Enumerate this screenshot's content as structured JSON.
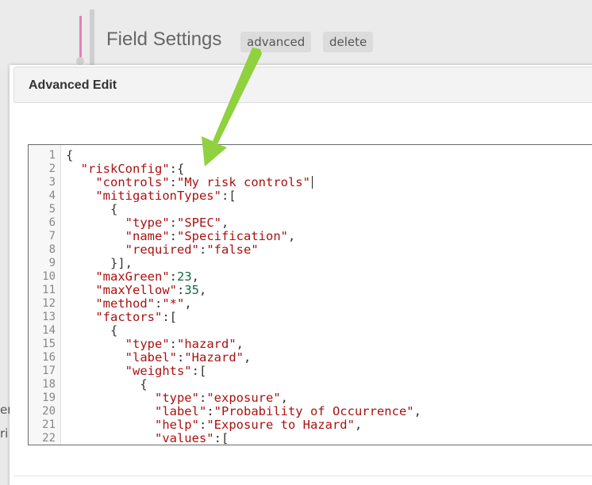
{
  "background": {
    "field_settings_title": "Field Settings",
    "advanced_button": "advanced",
    "delete_button": "delete",
    "edge_text_1": "er",
    "edge_text_2": "ri"
  },
  "modal": {
    "title": "Advanced Edit"
  },
  "editor": {
    "lines": [
      {
        "n": "1",
        "text": "{"
      },
      {
        "n": "2",
        "text": "  \"riskConfig\":{"
      },
      {
        "n": "3",
        "text": "    \"controls\":\"My risk controls\""
      },
      {
        "n": "4",
        "text": "    \"mitigationTypes\":["
      },
      {
        "n": "5",
        "text": "      {"
      },
      {
        "n": "6",
        "text": "        \"type\":\"SPEC\","
      },
      {
        "n": "7",
        "text": "        \"name\":\"Specification\","
      },
      {
        "n": "8",
        "text": "        \"required\":\"false\""
      },
      {
        "n": "9",
        "text": "      }],"
      },
      {
        "n": "10",
        "text": "    \"maxGreen\":23,"
      },
      {
        "n": "11",
        "text": "    \"maxYellow\":35,"
      },
      {
        "n": "12",
        "text": "    \"method\":\"*\","
      },
      {
        "n": "13",
        "text": "    \"factors\":["
      },
      {
        "n": "14",
        "text": "      {"
      },
      {
        "n": "15",
        "text": "        \"type\":\"hazard\","
      },
      {
        "n": "16",
        "text": "        \"label\":\"Hazard\","
      },
      {
        "n": "17",
        "text": "        \"weights\":["
      },
      {
        "n": "18",
        "text": "          {"
      },
      {
        "n": "19",
        "text": "            \"type\":\"exposure\","
      },
      {
        "n": "20",
        "text": "            \"label\":\"Probability of Occurrence\","
      },
      {
        "n": "21",
        "text": "            \"help\":\"Exposure to Hazard\","
      },
      {
        "n": "22",
        "text": "            \"values\":["
      }
    ]
  },
  "colors": {
    "arrow": "#8fd13f",
    "string": "#aa1111",
    "number": "#116644"
  }
}
